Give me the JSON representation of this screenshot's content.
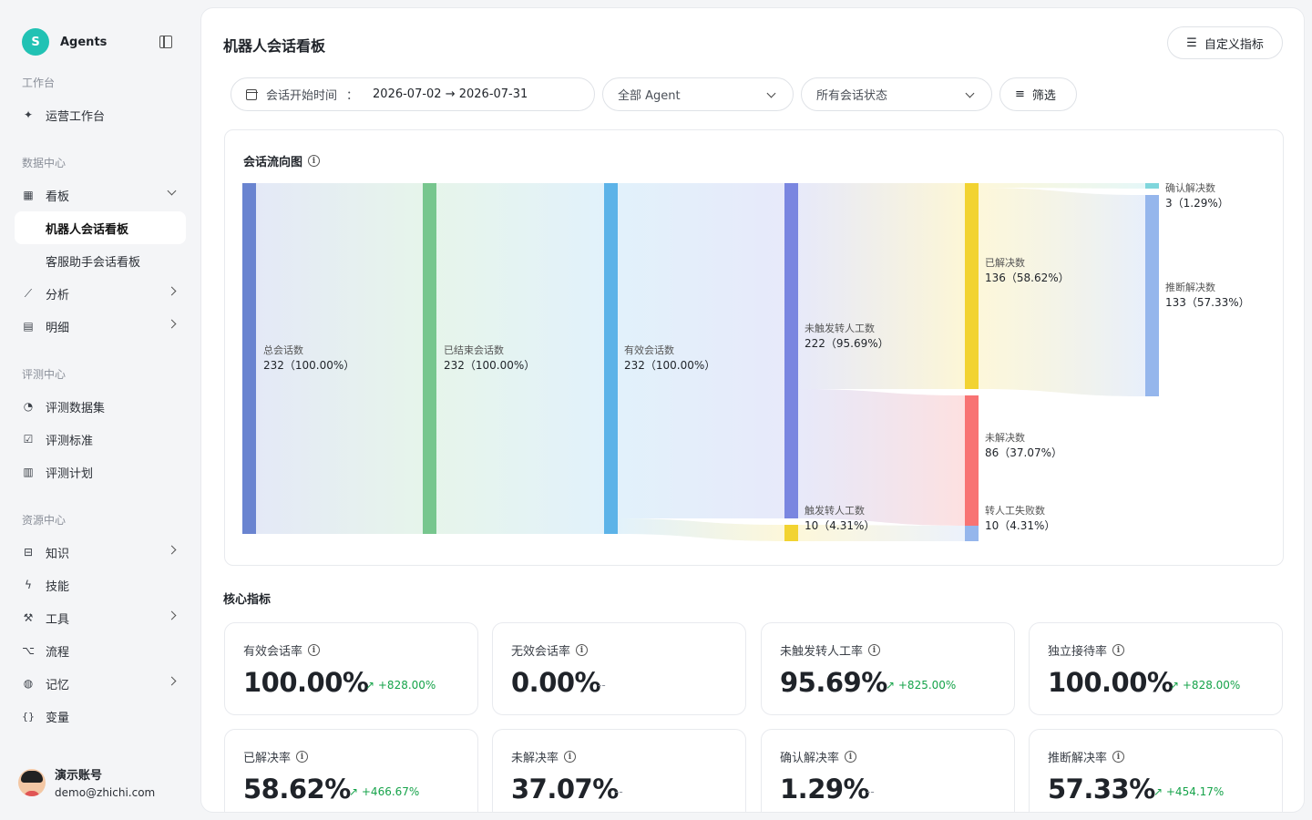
{
  "sidebar": {
    "brand": {
      "logo_letter": "S",
      "name": "Agents"
    },
    "sections": {
      "workbench": "工作台",
      "data": "数据中心",
      "eval": "评测中心",
      "resource": "资源中心"
    },
    "items": {
      "ops": "运营工作台",
      "board": "看板",
      "bot_board": "机器人会话看板",
      "cs_board": "客服助手会话看板",
      "analysis": "分析",
      "detail": "明细",
      "eval_dataset": "评测数据集",
      "eval_standard": "评测标准",
      "eval_plan": "评测计划",
      "knowledge": "知识",
      "skills": "技能",
      "tools": "工具",
      "flow": "流程",
      "memory": "记忆",
      "variables": "变量"
    },
    "user": {
      "name": "演示账号",
      "email": "demo@zhichi.com"
    }
  },
  "header": {
    "title": "机器人会话看板",
    "custom_button": "自定义指标"
  },
  "filters": {
    "date_label": "会话开始时间",
    "date_colon": "：",
    "date_range": "2026-07-02 → 2026-07-31",
    "agent": "全部 Agent",
    "status": "所有会话状态",
    "filter_button": "筛选"
  },
  "sankey": {
    "title": "会话流向图",
    "nodes": [
      {
        "key": "total",
        "label": "总会话数",
        "value": "232（100.00%）",
        "color": "#6a84d0"
      },
      {
        "key": "ended",
        "label": "已结束会话数",
        "value": "232（100.00%）",
        "color": "#77c68e"
      },
      {
        "key": "valid",
        "label": "有效会话数",
        "value": "232（100.00%）",
        "color": "#5cb3e8"
      },
      {
        "key": "no_transfer",
        "label": "未触发转人工数",
        "value": "222（95.69%）",
        "color": "#7a86e0"
      },
      {
        "key": "transfer",
        "label": "触发转人工数",
        "value": "10（4.31%）",
        "color": "#f2d331"
      },
      {
        "key": "resolved",
        "label": "已解决数",
        "value": "136（58.62%）",
        "color": "#f2d331"
      },
      {
        "key": "unresolved",
        "label": "未解决数",
        "value": "86（37.07%）",
        "color": "#f87373"
      },
      {
        "key": "transfer_failed",
        "label": "转人工失败数",
        "value": "10（4.31%）",
        "color": "#95b6ec"
      },
      {
        "key": "confirmed",
        "label": "确认解决数",
        "value": "3（1.29%）",
        "color": "#7fd6dc"
      },
      {
        "key": "inferred",
        "label": "推断解决数",
        "value": "133（57.33%）",
        "color": "#95b6ec"
      }
    ]
  },
  "core": {
    "title": "核心指标",
    "metrics": [
      {
        "label": "有效会话率",
        "value": "100.00%",
        "change": "+828.00%",
        "trend": "up"
      },
      {
        "label": "无效会话率",
        "value": "0.00%",
        "change": "--",
        "trend": "none"
      },
      {
        "label": "未触发转人工率",
        "value": "95.69%",
        "change": "+825.00%",
        "trend": "up"
      },
      {
        "label": "独立接待率",
        "value": "100.00%",
        "change": "+828.00%",
        "trend": "up"
      },
      {
        "label": "已解决率",
        "value": "58.62%",
        "change": "+466.67%",
        "trend": "up"
      },
      {
        "label": "未解决率",
        "value": "37.07%",
        "change": "--",
        "trend": "none"
      },
      {
        "label": "确认解决率",
        "value": "1.29%",
        "change": "--",
        "trend": "none"
      },
      {
        "label": "推断解决率",
        "value": "57.33%",
        "change": "+454.17%",
        "trend": "up"
      }
    ]
  }
}
